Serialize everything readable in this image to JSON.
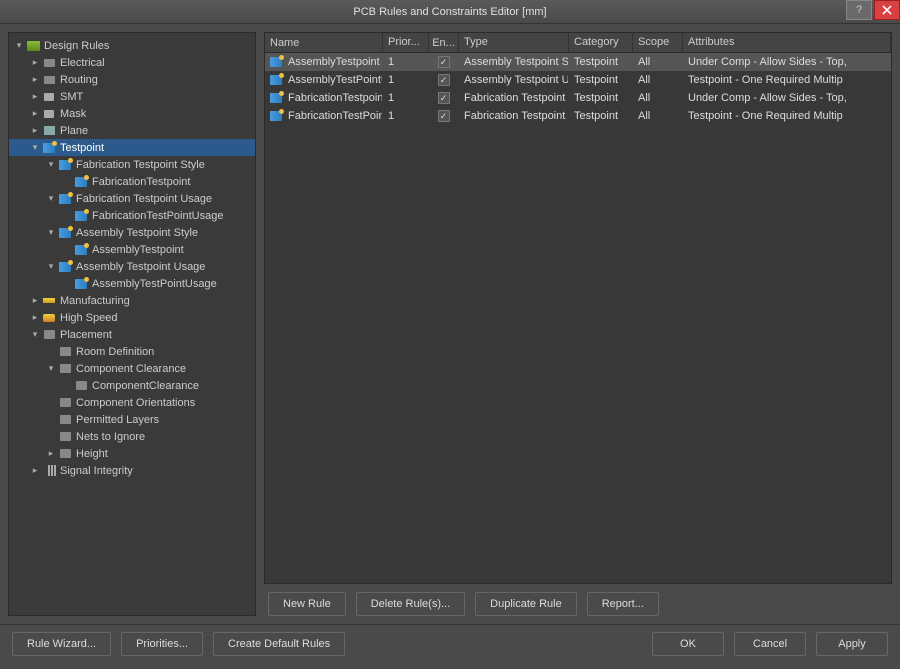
{
  "title": "PCB Rules and Constraints Editor [mm]",
  "tree": [
    {
      "depth": 0,
      "toggle": "down",
      "icon": "folder",
      "label": "Design Rules"
    },
    {
      "depth": 1,
      "toggle": "right",
      "icon": "elec",
      "label": "Electrical"
    },
    {
      "depth": 1,
      "toggle": "right",
      "icon": "elec",
      "label": "Routing"
    },
    {
      "depth": 1,
      "toggle": "right",
      "icon": "smt",
      "label": "SMT"
    },
    {
      "depth": 1,
      "toggle": "right",
      "icon": "smt",
      "label": "Mask"
    },
    {
      "depth": 1,
      "toggle": "right",
      "icon": "plane",
      "label": "Plane"
    },
    {
      "depth": 1,
      "toggle": "down",
      "icon": "rule",
      "label": "Testpoint",
      "selected": true
    },
    {
      "depth": 2,
      "toggle": "down",
      "icon": "rule",
      "label": "Fabrication Testpoint Style"
    },
    {
      "depth": 3,
      "toggle": "",
      "icon": "rule",
      "label": "FabricationTestpoint"
    },
    {
      "depth": 2,
      "toggle": "down",
      "icon": "rule",
      "label": "Fabrication Testpoint Usage"
    },
    {
      "depth": 3,
      "toggle": "",
      "icon": "rule",
      "label": "FabricationTestPointUsage"
    },
    {
      "depth": 2,
      "toggle": "down",
      "icon": "rule",
      "label": "Assembly Testpoint Style"
    },
    {
      "depth": 3,
      "toggle": "",
      "icon": "rule",
      "label": "AssemblyTestpoint"
    },
    {
      "depth": 2,
      "toggle": "down",
      "icon": "rule",
      "label": "Assembly Testpoint Usage"
    },
    {
      "depth": 3,
      "toggle": "",
      "icon": "rule",
      "label": "AssemblyTestPointUsage"
    },
    {
      "depth": 1,
      "toggle": "right",
      "icon": "manuf",
      "label": "Manufacturing"
    },
    {
      "depth": 1,
      "toggle": "right",
      "icon": "speed",
      "label": "High Speed"
    },
    {
      "depth": 1,
      "toggle": "down",
      "icon": "leaf",
      "label": "Placement"
    },
    {
      "depth": 2,
      "toggle": "",
      "icon": "leaf",
      "label": "Room Definition"
    },
    {
      "depth": 2,
      "toggle": "down",
      "icon": "leaf",
      "label": "Component Clearance"
    },
    {
      "depth": 3,
      "toggle": "",
      "icon": "leaf",
      "label": "ComponentClearance"
    },
    {
      "depth": 2,
      "toggle": "",
      "icon": "leaf",
      "label": "Component Orientations"
    },
    {
      "depth": 2,
      "toggle": "",
      "icon": "leaf",
      "label": "Permitted Layers"
    },
    {
      "depth": 2,
      "toggle": "",
      "icon": "leaf",
      "label": "Nets to Ignore"
    },
    {
      "depth": 2,
      "toggle": "right",
      "icon": "leaf",
      "label": "Height"
    },
    {
      "depth": 1,
      "toggle": "right",
      "icon": "sig",
      "label": "Signal Integrity"
    }
  ],
  "columns": {
    "name": "Name",
    "prior": "Prior...",
    "en": "En...",
    "type": "Type",
    "cat": "Category",
    "scope": "Scope",
    "attr": "Attributes"
  },
  "rows": [
    {
      "name": "AssemblyTestpoint",
      "prior": "1",
      "en": true,
      "type": "Assembly Testpoint S",
      "cat": "Testpoint",
      "scope": "All",
      "attr": "Under Comp - Allow    Sides - Top,",
      "selected": true
    },
    {
      "name": "AssemblyTestPointU",
      "prior": "1",
      "en": true,
      "type": "Assembly Testpoint U",
      "cat": "Testpoint",
      "scope": "All",
      "attr": "Testpoint - One Required    Multip"
    },
    {
      "name": "FabricationTestpoin",
      "prior": "1",
      "en": true,
      "type": "Fabrication Testpoint",
      "cat": "Testpoint",
      "scope": "All",
      "attr": "Under Comp - Allow    Sides - Top,"
    },
    {
      "name": "FabricationTestPoin",
      "prior": "1",
      "en": true,
      "type": "Fabrication Testpoint",
      "cat": "Testpoint",
      "scope": "All",
      "attr": "Testpoint - One Required    Multip"
    }
  ],
  "actions": {
    "new": "New Rule",
    "delete": "Delete Rule(s)...",
    "duplicate": "Duplicate Rule",
    "report": "Report..."
  },
  "footer": {
    "wizard": "Rule Wizard...",
    "priorities": "Priorities...",
    "defaults": "Create Default Rules",
    "ok": "OK",
    "cancel": "Cancel",
    "apply": "Apply"
  }
}
